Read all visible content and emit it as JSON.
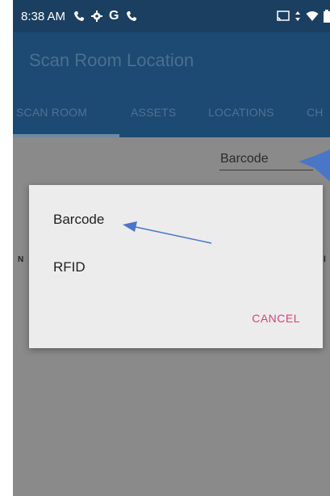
{
  "status_bar": {
    "time": "8:38 AM",
    "left_icons": [
      "phone-icon",
      "gear-icon",
      "google-icon",
      "phone-icon"
    ],
    "right_icons": [
      "cast-icon",
      "data-arrows-icon",
      "wifi-icon",
      "battery-icon"
    ]
  },
  "app_bar": {
    "title": "Scan Room Location"
  },
  "tabs": [
    {
      "label": "SCAN ROOM",
      "selected": true
    },
    {
      "label": "ASSETS",
      "selected": false
    },
    {
      "label": "LOCATIONS",
      "selected": false
    },
    {
      "label": "CH",
      "selected": false
    }
  ],
  "spinner": {
    "value": "Barcode"
  },
  "background_edge_text": {
    "left": "N",
    "right": "l"
  },
  "dialog": {
    "options": [
      "Barcode",
      "RFID"
    ],
    "cancel_label": "CANCEL"
  },
  "colors": {
    "status_bar": "#1a3f60",
    "app_bar": "#1c4a72",
    "accent": "#d8407e",
    "annotation_arrow": "#4a76c8",
    "dim_background": "#8a8a8a"
  }
}
